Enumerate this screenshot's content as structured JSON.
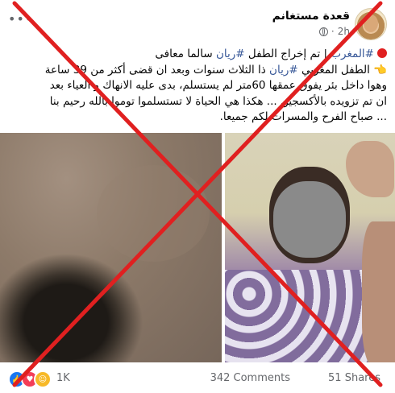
{
  "post": {
    "author": "قعدة مستغانم",
    "time": "2h",
    "line1_tag": "#المغرب",
    "line1_rest": " | تم إخراج الطفل ",
    "line1_tag2": "#ريان",
    "line1_end": " سالما معافى",
    "line2_start": "👈 الطفل المغربي ",
    "line2_tag": "#ريان",
    "line2_end": " ذا الثلاث سنوات وبعد ان قضى أكثر من 39 ساعة",
    "line3": "وهوا داخل بئر يفوق عمقها 60متر لم يستسلم، بدى عليه الانهاك و العياء بعد",
    "line4": "ان تم تزويده بالأكسجين ... هكذا هي الحياة لا تستسلموا توموا بالله رحيم بنا",
    "line5": "... صباح الفرح والمسرات لكم جميعا."
  },
  "icons": {
    "avatar": "page-avatar",
    "visibility": "globe-icon",
    "menu": "more-options-icon",
    "reactions": [
      "like-icon",
      "love-icon",
      "care-icon"
    ]
  },
  "footer": {
    "reaction_count": "1K",
    "comments": "342 Comments",
    "shares": "51 Shares"
  },
  "overlay": {
    "type": "red-x",
    "color": "#e02020"
  }
}
